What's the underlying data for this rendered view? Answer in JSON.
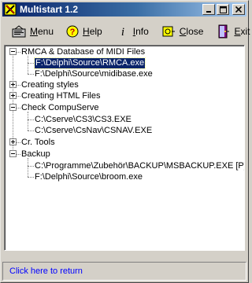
{
  "window": {
    "title": "Multistart 1.2"
  },
  "toolbar": {
    "menu": {
      "label": "Menu",
      "accel": "M",
      "rest": "enu"
    },
    "help": {
      "label": "Help",
      "accel": "H",
      "rest": "elp"
    },
    "info": {
      "label": "Info",
      "accel": "I",
      "rest": "nfo"
    },
    "close": {
      "label": "Close",
      "accel": "C",
      "rest": "lose"
    },
    "exit": {
      "label": "Exit",
      "accel": "E",
      "rest": "xit"
    }
  },
  "tree": {
    "nodes": [
      {
        "label": "RMCA & Database of MIDI Files",
        "expanded": true,
        "children": [
          {
            "label": "F:\\Delphi\\Source\\RMCA.exe",
            "selected": true
          },
          {
            "label": "F:\\Delphi\\Source\\midibase.exe"
          }
        ]
      },
      {
        "label": "Creating styles",
        "expanded": false
      },
      {
        "label": "Creating HTML Files",
        "expanded": false
      },
      {
        "label": "Check CompuServe",
        "expanded": true,
        "children": [
          {
            "label": "C:\\Cserve\\CS3\\CS3.EXE"
          },
          {
            "label": "C:\\Cserve\\CsNav\\CSNAV.EXE"
          }
        ]
      },
      {
        "label": "Cr. Tools",
        "expanded": false
      },
      {
        "label": "Backup",
        "expanded": true,
        "children": [
          {
            "label": "C:\\Programme\\Zubehör\\BACKUP\\MSBACKUP.EXE [P] K:\\Pe"
          },
          {
            "label": "F:\\Delphi\\Source\\broom.exe"
          }
        ]
      }
    ]
  },
  "footer": {
    "return_label": "Click here to return"
  },
  "colors": {
    "title_bar": "#0a246a",
    "selection": "#0a246a",
    "link": "#0000ff",
    "face": "#d4d0c8"
  }
}
